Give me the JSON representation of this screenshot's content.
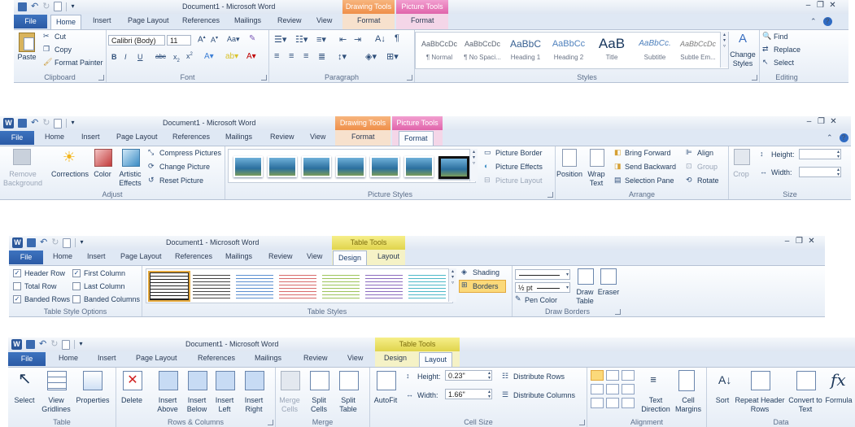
{
  "colors": {
    "accent": "#2b579a",
    "file_tab": "#2a5aa5",
    "drawing_tools": "#ef8f49",
    "picture_tools": "#e064ab",
    "table_tools": "#e0d44c"
  },
  "common": {
    "window_title": "Document1  -  Microsoft Word",
    "file": "File",
    "home": "Home",
    "insert": "Insert",
    "page_layout": "Page Layout",
    "references": "References",
    "mailings": "Mailings",
    "review": "Review",
    "view": "View",
    "format": "Format",
    "design": "Design",
    "layout": "Layout",
    "drawing_tools": "Drawing Tools",
    "picture_tools": "Picture Tools",
    "table_tools": "Table Tools",
    "help": "?"
  },
  "home": {
    "clipboard": {
      "paste": "Paste",
      "cut": "Cut",
      "copy": "Copy",
      "format_painter": "Format Painter",
      "label": "Clipboard"
    },
    "font": {
      "name": "Calibri (Body)",
      "size": "11",
      "label": "Font"
    },
    "paragraph": {
      "label": "Paragraph"
    },
    "styles": {
      "items": [
        {
          "sample": "AaBbCcDc",
          "name": "¶ Normal"
        },
        {
          "sample": "AaBbCcDc",
          "name": "¶ No Spaci..."
        },
        {
          "sample": "AaBbC",
          "name": "Heading 1"
        },
        {
          "sample": "AaBbCc",
          "name": "Heading 2"
        },
        {
          "sample": "AaB",
          "name": "Title"
        },
        {
          "sample": "AaBbCc.",
          "name": "Subtitle"
        },
        {
          "sample": "AaBbCcDc",
          "name": "Subtle Em..."
        }
      ],
      "change_styles": "Change Styles",
      "label": "Styles"
    },
    "editing": {
      "find": "Find",
      "replace": "Replace",
      "select": "Select",
      "label": "Editing"
    }
  },
  "picture": {
    "remove_bg": "Remove Background",
    "corrections": "Corrections",
    "color": "Color",
    "artistic": "Artistic Effects",
    "compress": "Compress Pictures",
    "change": "Change Picture",
    "reset": "Reset Picture",
    "adjust_label": "Adjust",
    "styles_label": "Picture Styles",
    "border": "Picture Border",
    "effects": "Picture Effects",
    "pic_layout": "Picture Layout",
    "position": "Position",
    "wrap": "Wrap Text",
    "bring_forward": "Bring Forward",
    "send_backward": "Send Backward",
    "selection_pane": "Selection Pane",
    "align": "Align",
    "group": "Group",
    "rotate": "Rotate",
    "arrange_label": "Arrange",
    "crop": "Crop",
    "height": "Height:",
    "width": "Width:",
    "size_label": "Size"
  },
  "design": {
    "header_row": "Header Row",
    "total_row": "Total Row",
    "banded_rows": "Banded Rows",
    "first_column": "First Column",
    "last_column": "Last Column",
    "banded_columns": "Banded Columns",
    "options_label": "Table Style Options",
    "styles_label": "Table Styles",
    "shading": "Shading",
    "borders": "Borders",
    "pen_weight": "½ pt",
    "pen_color": "Pen Color",
    "draw_table": "Draw Table",
    "eraser": "Eraser",
    "draw_borders_label": "Draw Borders"
  },
  "layout": {
    "select": "Select",
    "view_gridlines": "View Gridlines",
    "properties": "Properties",
    "table_label": "Table",
    "delete": "Delete",
    "insert_above": "Insert Above",
    "insert_below": "Insert Below",
    "insert_left": "Insert Left",
    "insert_right": "Insert Right",
    "rows_cols_label": "Rows & Columns",
    "merge_cells": "Merge Cells",
    "split_cells": "Split Cells",
    "split_table": "Split Table",
    "merge_label": "Merge",
    "autofit": "AutoFit",
    "height": "Height:",
    "height_value": "0.23\"",
    "width": "Width:",
    "width_value": "1.66\"",
    "distribute_rows": "Distribute Rows",
    "distribute_columns": "Distribute Columns",
    "cell_size_label": "Cell Size",
    "text_direction": "Text Direction",
    "cell_margins": "Cell Margins",
    "alignment_label": "Alignment",
    "sort": "Sort",
    "repeat_header": "Repeat Header Rows",
    "convert": "Convert to Text",
    "formula": "Formula",
    "data_label": "Data"
  }
}
